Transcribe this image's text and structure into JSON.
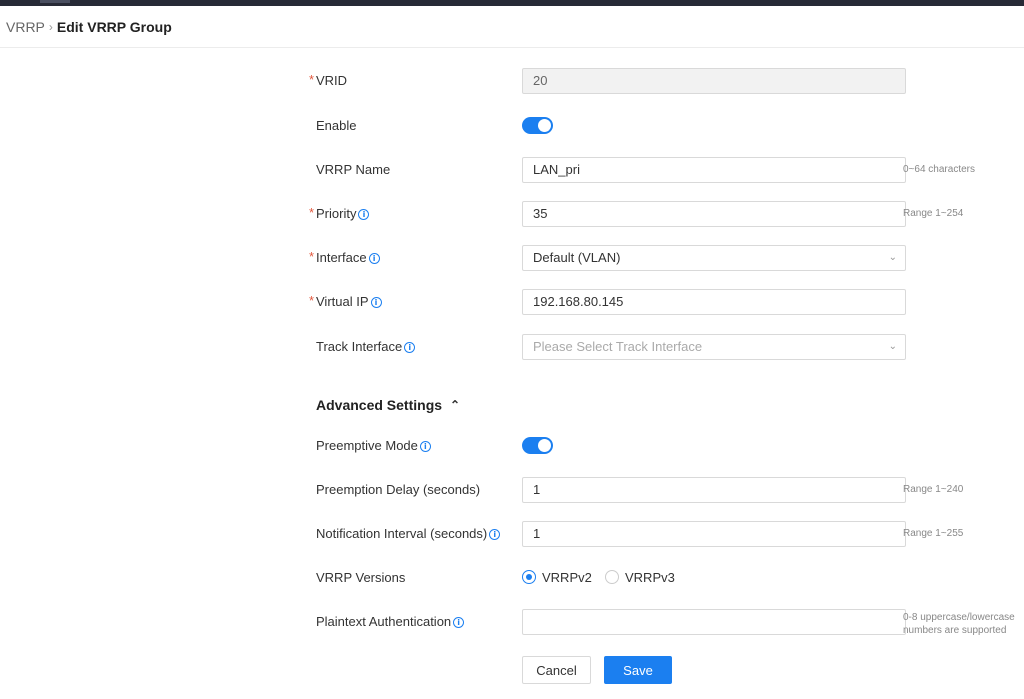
{
  "breadcrumb": {
    "parent": "VRRP",
    "current": "Edit VRRP Group"
  },
  "fields": {
    "vrid": {
      "label": "VRID",
      "value": "20"
    },
    "enable": {
      "label": "Enable",
      "on": true
    },
    "vrrp_name": {
      "label": "VRRP Name",
      "value": "LAN_pri",
      "hint": "0~64 characters"
    },
    "priority": {
      "label": "Priority",
      "value": "35",
      "hint": "Range 1~254"
    },
    "interface": {
      "label": "Interface",
      "value": "Default (VLAN)"
    },
    "virtual_ip": {
      "label": "Virtual IP",
      "value": "192.168.80.145"
    },
    "track_interface": {
      "label": "Track Interface",
      "placeholder": "Please Select Track Interface"
    }
  },
  "advanced": {
    "title": "Advanced Settings",
    "preemptive_mode": {
      "label": "Preemptive Mode",
      "on": true
    },
    "preemption_delay": {
      "label": "Preemption Delay (seconds)",
      "value": "1",
      "hint": "Range 1~240"
    },
    "notification_interval": {
      "label": "Notification Interval (seconds)",
      "value": "1",
      "hint": "Range 1~255"
    },
    "vrrp_versions": {
      "label": "VRRP Versions",
      "options": [
        "VRRPv2",
        "VRRPv3"
      ],
      "selected": "VRRPv2"
    },
    "plaintext_auth": {
      "label": "Plaintext Authentication",
      "value": "",
      "hint_line1": "0-8 uppercase/lowercase",
      "hint_line2": "numbers are supported"
    }
  },
  "buttons": {
    "cancel": "Cancel",
    "save": "Save"
  },
  "colors": {
    "accent": "#1b7ff0",
    "required": "#e2583e",
    "topbar": "#272a36"
  }
}
